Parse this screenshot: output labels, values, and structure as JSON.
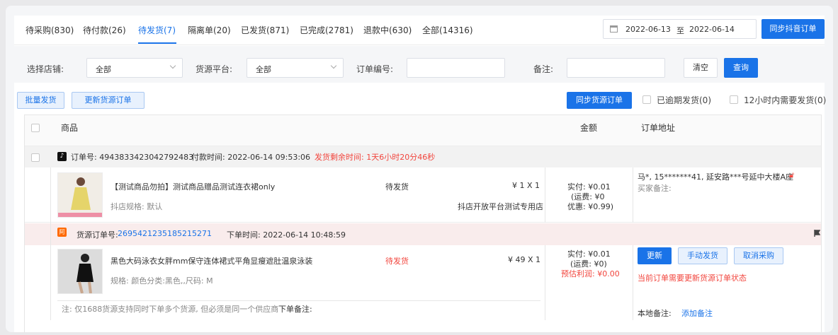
{
  "tabs": [
    {
      "label": "待采购(830)"
    },
    {
      "label": "待付款(26)"
    },
    {
      "label": "待发货(7)"
    },
    {
      "label": "隔离单(20)"
    },
    {
      "label": "已发货(871)"
    },
    {
      "label": "已完成(2781)"
    },
    {
      "label": "退款中(630)"
    },
    {
      "label": "全部(14316)"
    }
  ],
  "date_range": {
    "start": "2022-06-13",
    "separator": "至",
    "end": "2022-06-14"
  },
  "sync_douyin_label": "同步抖音订单",
  "filters": {
    "store_label": "选择店铺:",
    "store_value": "全部",
    "platform_label": "货源平台:",
    "platform_value": "全部",
    "order_no_label": "订单编号:",
    "remark_label": "备注:",
    "clear_label": "清空",
    "query_label": "查询"
  },
  "actions": {
    "batch_ship": "批量发货",
    "update_source": "更新货源订单",
    "sync_source": "同步货源订单",
    "overdue_label": "已逾期发货(0)",
    "within12_label": "12小时内需要发货(0)"
  },
  "table_header": {
    "product": "商品",
    "amount": "金额",
    "address": "订单地址"
  },
  "order": {
    "order_no": "订单号: 4943833423042792483",
    "pay_time": "付款时间: 2022-06-14 09:53:06",
    "remaining": "发货剩余时间: 1天6小时20分46秒",
    "product_title": "【测试商品勿拍】测试商品赠品测试连衣裙only",
    "spec": "抖店规格: 默认",
    "status": "待发货",
    "price_qty": "¥ 1 X 1",
    "store": "抖店开放平台测试专用店",
    "paid": "实付: ¥0.01",
    "shipping": "(运费: ¥0",
    "discount": "优惠: ¥0.99)",
    "address": "马*,  15*******41, 延安路***号延中大楼A座",
    "buyer_remark": "买家备注:"
  },
  "source_order": {
    "source_no_label": "货源订单号:",
    "source_no": "2695421235185215271",
    "order_time": "下单时间: 2022-06-14 10:48:59",
    "product_title": "黑色大码泳衣女胖mm保守连体裙式平角显瘦遮肚温泉泳装",
    "spec": "规格: 颜色分类:黑色,,尺码: M",
    "status": "待发货",
    "price_qty": "¥ 49 X 1",
    "paid": "实付: ¥0.01",
    "shipping": "(运费: ¥0)",
    "profit": "预估利润: ¥0.00",
    "update_btn": "更新",
    "manual_ship_btn": "手动发货",
    "cancel_btn": "取消采购",
    "warning": "当前订单需要更新货源订单状态",
    "note": "注: 仅1688货源支持同时下单多个货源, 但必须是同一个供应商",
    "order_remark_label": "下单备注:",
    "local_remark_label": "本地备注:",
    "add_remark": "添加备注"
  },
  "colors": {
    "accent": "#1a73e8",
    "danger": "#f2453d"
  }
}
